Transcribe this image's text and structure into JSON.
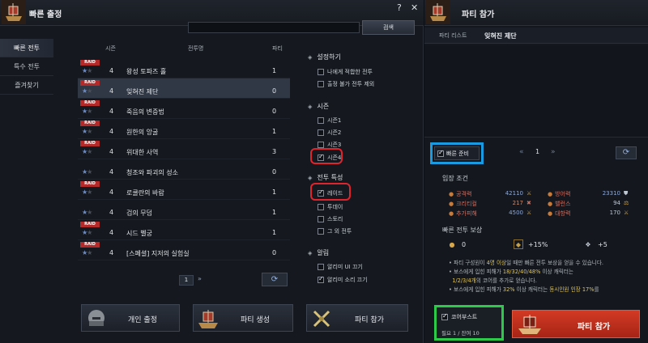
{
  "left": {
    "title": "빠른 출정",
    "help_icon": "help-icon",
    "close_icon": "close-icon",
    "search": {
      "placeholder": "",
      "button_label": "검색"
    },
    "sidebar": [
      "빠른 전투",
      "특수 전투",
      "즐겨찾기"
    ],
    "columns": {
      "season": "시즌",
      "name": "전투명",
      "party": "파티"
    },
    "rows": [
      {
        "badge": "RAID",
        "stars": 1,
        "season": "4",
        "name": "왕성 토파즈 홀",
        "party": "1"
      },
      {
        "badge": "RAID",
        "stars": 1,
        "season": "4",
        "name": "잊혀진 제단",
        "party": "0"
      },
      {
        "badge": "RAID",
        "stars": 1,
        "season": "4",
        "name": "죽음의 변증법",
        "party": "0"
      },
      {
        "badge": "RAID",
        "stars": 1,
        "season": "4",
        "name": "원한의 앙굴",
        "party": "1"
      },
      {
        "badge": "RAID",
        "stars": 1,
        "season": "4",
        "name": "위대한 사역",
        "party": "3"
      },
      {
        "badge": "",
        "stars": 1,
        "season": "4",
        "name": "청조와 파괴의 성소",
        "party": "0"
      },
      {
        "badge": "RAID",
        "stars": 1,
        "season": "4",
        "name": "로쿨란의 바람",
        "party": "1"
      },
      {
        "badge": "",
        "stars": 1,
        "season": "4",
        "name": "검의 무덤",
        "party": "1"
      },
      {
        "badge": "RAID",
        "stars": 1,
        "season": "4",
        "name": "시드 벨궁",
        "party": "1"
      },
      {
        "badge": "RAID",
        "stars": 1,
        "season": "4",
        "name": "[스페셜] 지저의 실험실",
        "party": "0"
      }
    ],
    "pager": {
      "page": "1",
      "next": "»"
    },
    "filters": {
      "settings": {
        "title": "설정하기",
        "items": [
          "나에게 적합한 전투",
          "출정 불가 전투 제외"
        ]
      },
      "season": {
        "title": "시즌",
        "items": [
          "시즌1",
          "시즌2",
          "시즌3",
          "시즌4"
        ]
      },
      "type": {
        "title": "전투 특성",
        "items": [
          "레이드",
          "투데이",
          "스토리",
          "그 외 전투"
        ]
      },
      "alarm": {
        "title": "알림",
        "items": [
          "알리미 UI 끄기",
          "알리미 소리 끄기"
        ]
      }
    },
    "buttons": {
      "solo": "개인 출정",
      "create": "파티 생성",
      "join": "파티 참가"
    }
  },
  "right": {
    "title": "파티 참가",
    "party_list_label": "파티 리스트",
    "party_list_value": "잊혀진 제단",
    "ready_label": "빠른 준비",
    "page": "1",
    "prev": "«",
    "next": "»",
    "entry_title": "입장 조건",
    "stats": [
      {
        "label": "공격력",
        "value": "42110"
      },
      {
        "label": "방어력",
        "value": "23310"
      },
      {
        "label": "크리티컬",
        "value": "217"
      },
      {
        "label": "밸런스",
        "value": "94"
      },
      {
        "label": "추가피해",
        "value": "4500"
      },
      {
        "label": "대항력",
        "value": "170"
      }
    ],
    "reward_title": "빠른 전투 보상",
    "rewards": [
      "0",
      "+15%",
      "+5"
    ],
    "notes": {
      "n1a": "파티 구성원이 ",
      "n1y": "4명 이상",
      "n1b": "일 때만 빠른 전투 보상을 얻을 수 있습니다.",
      "n2": "보스에게 입힌 피해가 ",
      "n2y": "18/32/40/48%",
      "n2b": " 이상 캐릭터는",
      "n3y": "1/2/3/4개",
      "n3b": "의 코어를 추가로 얻습니다.",
      "n4a": "보스에게 입힌 피해가 ",
      "n4y": "32%",
      "n4b": " 이상 캐릭터는 ",
      "n4c": "동시인원 인장 17%",
      "n4d": "를"
    },
    "booster": {
      "label": "코어부스트",
      "sub": "필요 1 / 잔여 10"
    },
    "join_button": "파티 참가",
    "accent": "#1a9ae0",
    "booster_highlight": "#2fc94a",
    "filter_highlight": "#e0242d"
  }
}
